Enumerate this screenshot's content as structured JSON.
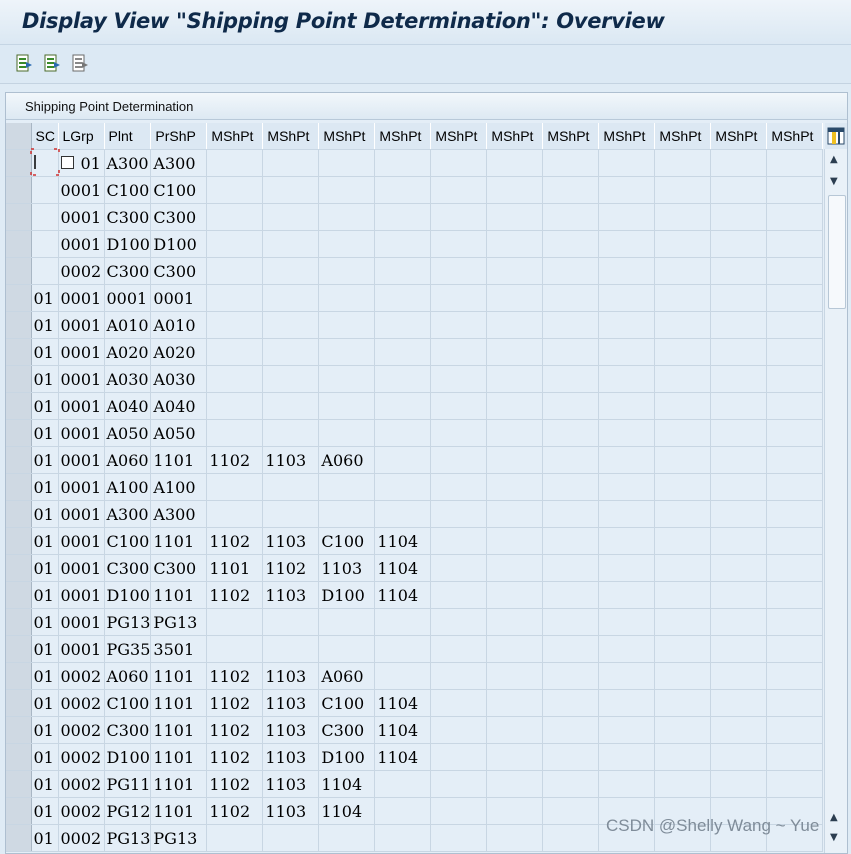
{
  "window": {
    "title": "Display View \"Shipping Point Determination\": Overview"
  },
  "toolbar": {
    "buttons": [
      {
        "icon": "export-table-icon"
      },
      {
        "icon": "export-table-icon"
      },
      {
        "icon": "export-table-icon"
      }
    ]
  },
  "panel": {
    "title": "Shipping Point Determination"
  },
  "table": {
    "columns": [
      "SC",
      "LGrp",
      "Plnt",
      "PrShP",
      "MShPt",
      "MShPt",
      "MShPt",
      "MShPt",
      "MShPt",
      "MShPt",
      "MShPt",
      "MShPt",
      "MShPt",
      "MShPt",
      "MShPt"
    ],
    "rows": [
      [
        "",
        "01",
        "A300",
        "A300",
        "",
        "",
        "",
        "",
        "",
        "",
        "",
        "",
        "",
        "",
        ""
      ],
      [
        "",
        "0001",
        "C100",
        "C100",
        "",
        "",
        "",
        "",
        "",
        "",
        "",
        "",
        "",
        "",
        ""
      ],
      [
        "",
        "0001",
        "C300",
        "C300",
        "",
        "",
        "",
        "",
        "",
        "",
        "",
        "",
        "",
        "",
        ""
      ],
      [
        "",
        "0001",
        "D100",
        "D100",
        "",
        "",
        "",
        "",
        "",
        "",
        "",
        "",
        "",
        "",
        ""
      ],
      [
        "",
        "0002",
        "C300",
        "C300",
        "",
        "",
        "",
        "",
        "",
        "",
        "",
        "",
        "",
        "",
        ""
      ],
      [
        "01",
        "0001",
        "0001",
        "0001",
        "",
        "",
        "",
        "",
        "",
        "",
        "",
        "",
        "",
        "",
        ""
      ],
      [
        "01",
        "0001",
        "A010",
        "A010",
        "",
        "",
        "",
        "",
        "",
        "",
        "",
        "",
        "",
        "",
        ""
      ],
      [
        "01",
        "0001",
        "A020",
        "A020",
        "",
        "",
        "",
        "",
        "",
        "",
        "",
        "",
        "",
        "",
        ""
      ],
      [
        "01",
        "0001",
        "A030",
        "A030",
        "",
        "",
        "",
        "",
        "",
        "",
        "",
        "",
        "",
        "",
        ""
      ],
      [
        "01",
        "0001",
        "A040",
        "A040",
        "",
        "",
        "",
        "",
        "",
        "",
        "",
        "",
        "",
        "",
        ""
      ],
      [
        "01",
        "0001",
        "A050",
        "A050",
        "",
        "",
        "",
        "",
        "",
        "",
        "",
        "",
        "",
        "",
        ""
      ],
      [
        "01",
        "0001",
        "A060",
        "1101",
        "1102",
        "1103",
        "A060",
        "",
        "",
        "",
        "",
        "",
        "",
        "",
        ""
      ],
      [
        "01",
        "0001",
        "A100",
        "A100",
        "",
        "",
        "",
        "",
        "",
        "",
        "",
        "",
        "",
        "",
        ""
      ],
      [
        "01",
        "0001",
        "A300",
        "A300",
        "",
        "",
        "",
        "",
        "",
        "",
        "",
        "",
        "",
        "",
        ""
      ],
      [
        "01",
        "0001",
        "C100",
        "1101",
        "1102",
        "1103",
        "C100",
        "1104",
        "",
        "",
        "",
        "",
        "",
        "",
        ""
      ],
      [
        "01",
        "0001",
        "C300",
        "C300",
        "1101",
        "1102",
        "1103",
        "1104",
        "",
        "",
        "",
        "",
        "",
        "",
        ""
      ],
      [
        "01",
        "0001",
        "D100",
        "1101",
        "1102",
        "1103",
        "D100",
        "1104",
        "",
        "",
        "",
        "",
        "",
        "",
        ""
      ],
      [
        "01",
        "0001",
        "PG13",
        "PG13",
        "",
        "",
        "",
        "",
        "",
        "",
        "",
        "",
        "",
        "",
        ""
      ],
      [
        "01",
        "0001",
        "PG35",
        "3501",
        "",
        "",
        "",
        "",
        "",
        "",
        "",
        "",
        "",
        "",
        ""
      ],
      [
        "01",
        "0002",
        "A060",
        "1101",
        "1102",
        "1103",
        "A060",
        "",
        "",
        "",
        "",
        "",
        "",
        "",
        ""
      ],
      [
        "01",
        "0002",
        "C100",
        "1101",
        "1102",
        "1103",
        "C100",
        "1104",
        "",
        "",
        "",
        "",
        "",
        "",
        ""
      ],
      [
        "01",
        "0002",
        "C300",
        "1101",
        "1102",
        "1103",
        "C300",
        "1104",
        "",
        "",
        "",
        "",
        "",
        "",
        ""
      ],
      [
        "01",
        "0002",
        "D100",
        "1101",
        "1102",
        "1103",
        "D100",
        "1104",
        "",
        "",
        "",
        "",
        "",
        "",
        ""
      ],
      [
        "01",
        "0002",
        "PG11",
        "1101",
        "1102",
        "1103",
        "1104",
        "",
        "",
        "",
        "",
        "",
        "",
        "",
        ""
      ],
      [
        "01",
        "0002",
        "PG12",
        "1101",
        "1102",
        "1103",
        "1104",
        "",
        "",
        "",
        "",
        "",
        "",
        "",
        ""
      ],
      [
        "01",
        "0002",
        "PG13",
        "PG13",
        "",
        "",
        "",
        "",
        "",
        "",
        "",
        "",
        "",
        "",
        ""
      ]
    ]
  },
  "watermark": {
    "text": "CSDN @Shelly Wang ~ Yue"
  },
  "colors": {
    "background": "#dfebf5",
    "title_text": "#0f2a4a",
    "grid_line": "#c8d6e3"
  }
}
